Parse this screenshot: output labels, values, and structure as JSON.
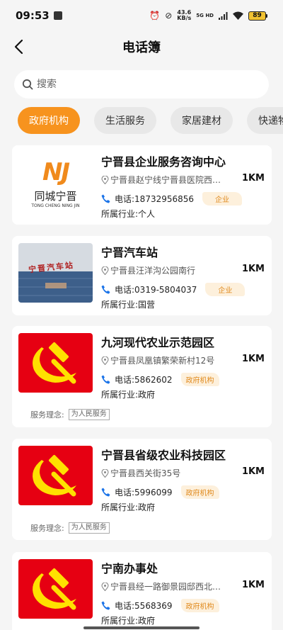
{
  "status": {
    "time": "09:53",
    "net_speed_value": "43.6",
    "net_speed_unit": "KB/s",
    "signal_label": "5G HD",
    "battery": "89"
  },
  "header": {
    "title": "电话簿"
  },
  "search": {
    "placeholder": "搜索"
  },
  "tabs": [
    {
      "label": "政府机构",
      "active": true
    },
    {
      "label": "生活服务",
      "active": false
    },
    {
      "label": "家居建材",
      "active": false
    },
    {
      "label": "快递物流",
      "active": false
    }
  ],
  "cards": [
    {
      "title": "宁晋县企业服务咨询中心",
      "address": "宁晋县赵宁线宁晋县医院西…",
      "distance": "1KM",
      "phone": "电话:18732956856",
      "tag": "企业",
      "industry": "所属行业:个人",
      "logo_big": "NJ",
      "logo_cn": "同城宁晋",
      "logo_en": "TONG CHENG NING JIN"
    },
    {
      "title": "宁晋汽车站",
      "address": "宁晋县汪洋沟公园南行",
      "distance": "1KM",
      "phone": "电话:0319-5804037",
      "tag": "企业",
      "industry": "所属行业:国营",
      "sign_text": "宁晋汽车站"
    },
    {
      "title": "九河现代农业示范园区",
      "address": "宁晋县凤凰镇繁荣新村12号",
      "distance": "1KM",
      "phone": "电话:5862602",
      "tag": "政府机构",
      "industry": "所属行业:政府",
      "motto_label": "服务理念:",
      "motto": "为人民服务"
    },
    {
      "title": "宁晋县省级农业科技园区",
      "address": "宁晋县西关街35号",
      "distance": "1KM",
      "phone": "电话:5996099",
      "tag": "政府机构",
      "industry": "所属行业:政府",
      "motto_label": "服务理念:",
      "motto": "为人民服务"
    },
    {
      "title": "宁南办事处",
      "address": "宁晋县经一路御景园邸西北…",
      "distance": "1KM",
      "phone": "电话:5568369",
      "tag": "政府机构",
      "industry": "所属行业:政府"
    }
  ],
  "colors": {
    "accent": "#f7931e",
    "tag_bg": "#fdf0dc",
    "tag_text": "#e08a1e",
    "flag_red": "#e60012",
    "flag_yellow": "#ffe100",
    "phone_blue": "#1a73e8"
  }
}
